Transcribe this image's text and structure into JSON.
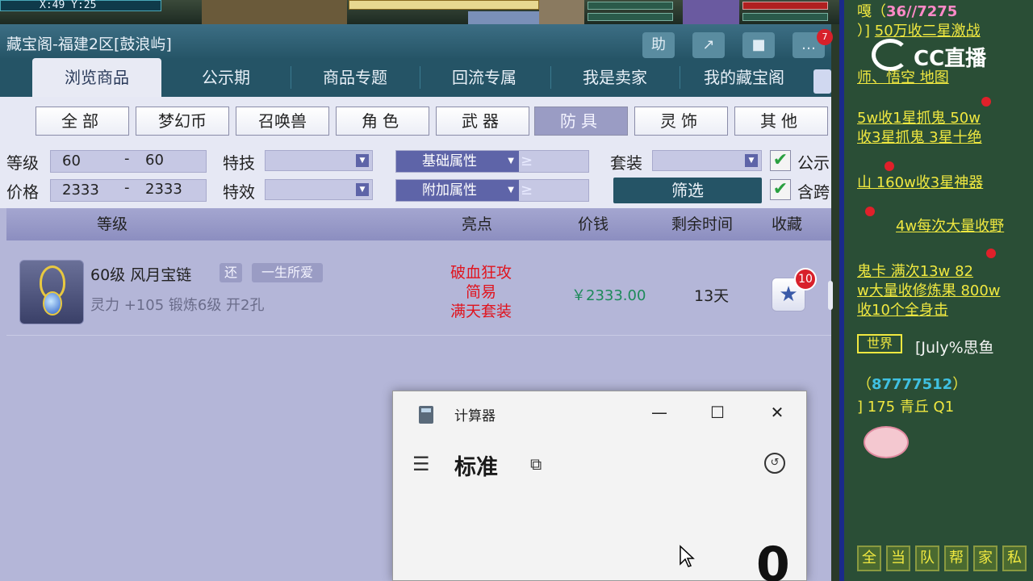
{
  "game": {
    "coords": "X:49 Y:25"
  },
  "store": {
    "title": "藏宝阁-福建2区[鼓浪屿]",
    "title_buttons": [
      "助",
      "↗",
      "■",
      "…"
    ],
    "notify_count": "7",
    "tabs": [
      {
        "label": "浏览商品",
        "active": true
      },
      {
        "label": "公示期",
        "active": false
      },
      {
        "label": "商品专题",
        "active": false
      },
      {
        "label": "回流专属",
        "active": false
      },
      {
        "label": "我是卖家",
        "active": false
      },
      {
        "label": "我的藏宝阁",
        "active": false
      }
    ],
    "categories": [
      {
        "label": "全部",
        "active": false
      },
      {
        "label": "梦幻币",
        "active": false
      },
      {
        "label": "召唤兽",
        "active": false
      },
      {
        "label": "角色",
        "active": false
      },
      {
        "label": "武器",
        "active": false
      },
      {
        "label": "防具",
        "active": true
      },
      {
        "label": "灵饰",
        "active": false
      },
      {
        "label": "其他",
        "active": false
      }
    ],
    "filters": {
      "level_label": "等级",
      "level_min": "60",
      "level_max": "60",
      "price_label": "价格",
      "price_min": "2333",
      "price_max": "2333",
      "skill_label": "特技",
      "effect_label": "特效",
      "base_attr_label": "基础属性",
      "extra_attr_label": "附加属性",
      "ge_symbol": "≥",
      "set_label": "套装",
      "filter_button": "筛选",
      "check1_label": "公示",
      "check2_label": "含跨",
      "dash": "-",
      "checkmark": "✔"
    },
    "table": {
      "headers": {
        "level": "等级",
        "highlight": "亮点",
        "price": "价钱",
        "remain": "剩余时间",
        "fav": "收藏"
      },
      "rows": [
        {
          "name": "60级 风月宝链",
          "badge1": "还",
          "badge2": "一生所爱",
          "attrs": "灵力 +105 锻炼6级 开2孔",
          "highlights": [
            "破血狂攻",
            "简易",
            "满天套装"
          ],
          "price": "￥2333.00",
          "remain": "13天",
          "fav_count": "10"
        }
      ]
    }
  },
  "chat": {
    "lines": [
      {
        "text": "嘎（",
        "class": ""
      },
      {
        "text": "36//7275",
        "class": "pink"
      },
      {
        "text": "）]",
        "class": ""
      },
      {
        "text": "50万收二星激战",
        "class": "link"
      },
      {
        "text": "师、悟空 地图",
        "class": "link"
      },
      {
        "text": "5w收1星抓鬼 50w",
        "class": "link"
      },
      {
        "text": "收3星抓鬼 3星十绝",
        "class": "link"
      },
      {
        "text": "山 160w收3星神器",
        "class": "link"
      },
      {
        "text": "4w每次大量收野",
        "class": "link"
      },
      {
        "text": "鬼卡 满次13w 82",
        "class": "link"
      },
      {
        "text": "w大量收修炼果 800w",
        "class": "link"
      },
      {
        "text": "收10个全身击",
        "class": "link"
      }
    ],
    "world_label": "世界",
    "world_sender": "[July%思鱼",
    "world_id_open": "（",
    "world_id": "87777512",
    "world_id_close": "）",
    "world_msg": "] 175 青丘 Q1",
    "logo_text": "CC直播",
    "channels": [
      "全",
      "当",
      "队",
      "帮",
      "家",
      "私"
    ]
  },
  "calculator": {
    "title": "计算器",
    "mode": "标准",
    "display": "0",
    "minimize": "—",
    "maximize": "☐",
    "close": "✕",
    "menu_icon": "☰",
    "keep_on_top_icon": "⧉",
    "history_icon": "↺"
  },
  "icons": {
    "star": "★"
  }
}
